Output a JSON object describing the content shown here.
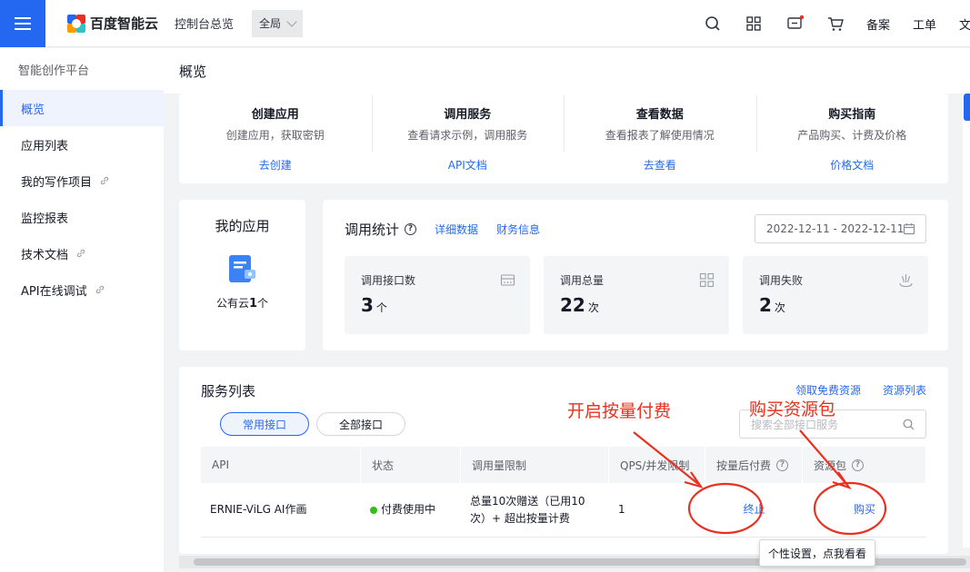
{
  "topbar": {
    "brand": "百度智能云",
    "console_link": "控制台总览",
    "region": "全局",
    "links": [
      "备案",
      "工单",
      "文"
    ]
  },
  "sidebar": {
    "title": "智能创作平台",
    "items": [
      {
        "label": "概览",
        "active": true
      },
      {
        "label": "应用列表"
      },
      {
        "label": "我的写作项目",
        "external": true
      },
      {
        "label": "监控报表"
      },
      {
        "label": "技术文档",
        "external": true
      },
      {
        "label": "API在线调试",
        "external": true
      }
    ]
  },
  "page": {
    "title": "概览"
  },
  "guide": [
    {
      "title": "创建应用",
      "desc": "创建应用，获取密钥",
      "link": "去创建"
    },
    {
      "title": "调用服务",
      "desc": "查看请求示例，调用服务",
      "link": "API文档"
    },
    {
      "title": "查看数据",
      "desc": "查看报表了解使用情况",
      "link": "去查看"
    },
    {
      "title": "购买指南",
      "desc": "产品购买、计费及价格",
      "link": "价格文档"
    }
  ],
  "my_app": {
    "title": "我的应用",
    "count_prefix": "公有云",
    "count": "1",
    "count_suffix": "个"
  },
  "stats": {
    "title": "调用统计",
    "links": [
      "详细数据",
      "财务信息"
    ],
    "date_range": "2022-12-11 - 2022-12-11",
    "boxes": [
      {
        "label": "调用接口数",
        "value": "3",
        "unit": "个",
        "icon": "interface-icon"
      },
      {
        "label": "调用总量",
        "value": "22",
        "unit": "次",
        "icon": "grid-icon"
      },
      {
        "label": "调用失败",
        "value": "2",
        "unit": "次",
        "icon": "fail-icon"
      }
    ]
  },
  "services": {
    "title": "服务列表",
    "links": [
      "领取免费资源",
      "资源列表"
    ],
    "tabs": [
      "常用接口",
      "全部接口"
    ],
    "search_placeholder": "搜索全部接口服务",
    "columns": [
      "API",
      "状态",
      "调用量限制",
      "QPS/并发限制",
      "按量后付费",
      "资源包"
    ],
    "rows": [
      {
        "api": "ERNIE-ViLG AI作画",
        "status": "付费使用中",
        "limit_line1": "总量10次赠送（已用10",
        "limit_line2": "次）+ 超出按量计费",
        "qps": "1",
        "postpaid": "终止",
        "package": "购买"
      }
    ]
  },
  "annotations": {
    "left": "开启按量付费",
    "right": "购买资源包"
  },
  "tooltip": "个性设置，点我看看",
  "colors": {
    "primary": "#2468f2",
    "annotation": "#e8311f",
    "status_ok": "#30bf13"
  }
}
